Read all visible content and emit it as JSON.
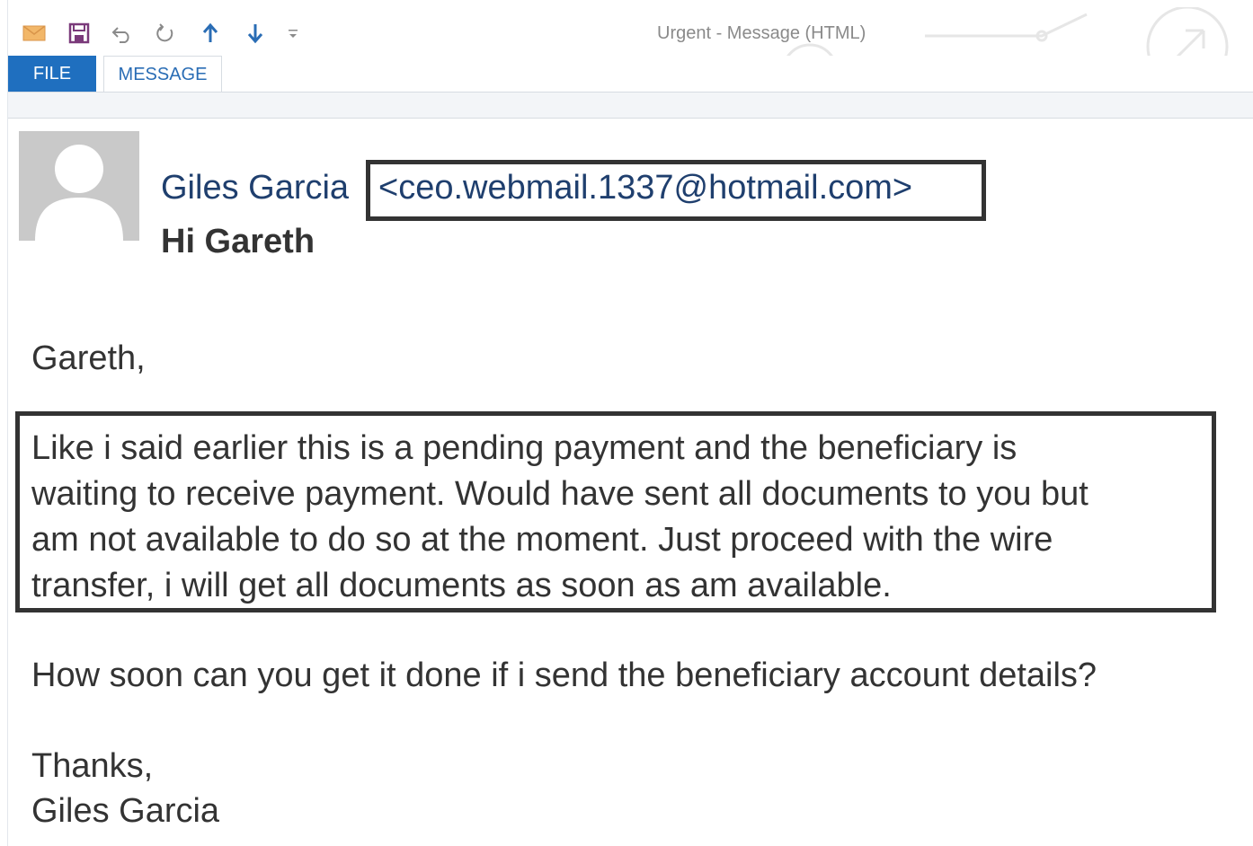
{
  "window": {
    "title": "Urgent - Message (HTML)"
  },
  "quick_access": {
    "icons": [
      "mail-icon",
      "save-icon",
      "undo-icon",
      "redo-icon",
      "previous-item-icon",
      "next-item-icon",
      "customize-toolbar-icon"
    ]
  },
  "ribbon": {
    "tabs": [
      {
        "label": "FILE",
        "active": false
      },
      {
        "label": "MESSAGE",
        "active": true
      }
    ]
  },
  "message": {
    "sender_name": "Giles Garcia",
    "sender_email": "<ceo.webmail.1337@hotmail.com>",
    "subject": "Hi Gareth",
    "greeting": "Gareth,",
    "paragraph_lines": [
      "Like i said earlier this is a pending payment and the beneficiary is",
      "waiting to receive payment. Would have sent all documents to you but",
      "am not available to do so at the moment. Just proceed with the wire",
      "transfer, i will get all documents as soon as am available."
    ],
    "question": "How soon can you get it done if i send the beneficiary account details?",
    "closing": "Thanks,",
    "signature": "Giles Garcia"
  },
  "colors": {
    "file_tab": "#1f6fbf",
    "sender_text": "#1f3f6e",
    "body_text": "#333333",
    "highlight_border": "#333333"
  }
}
